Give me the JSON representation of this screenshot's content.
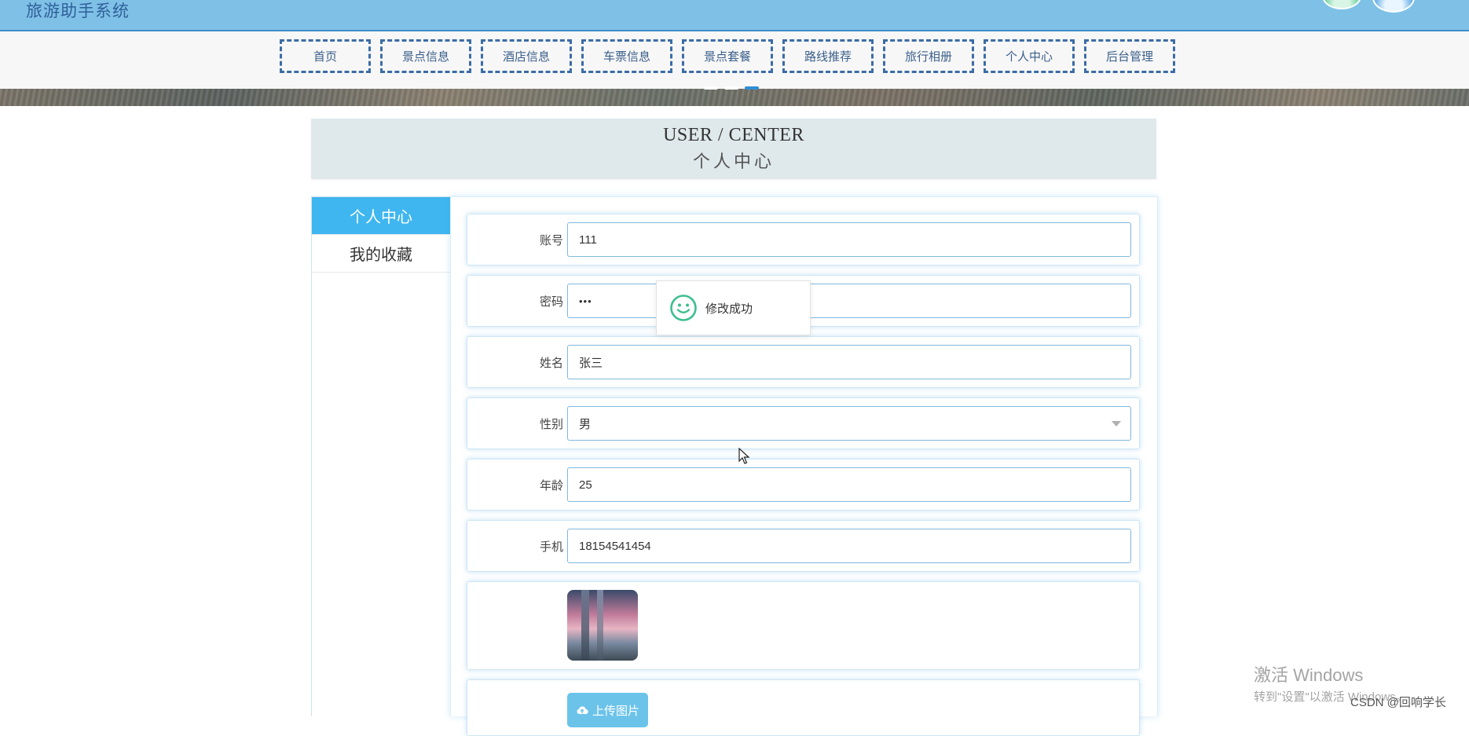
{
  "header": {
    "site_title": "旅游助手系统"
  },
  "nav": {
    "items": [
      "首页",
      "景点信息",
      "酒店信息",
      "车票信息",
      "景点套餐",
      "路线推荐",
      "旅行相册",
      "个人中心",
      "后台管理"
    ]
  },
  "section_header": {
    "title_en": "USER / CENTER",
    "title_cn": "个人中心"
  },
  "sidebar": {
    "items": [
      {
        "label": "个人中心",
        "active": true
      },
      {
        "label": "我的收藏",
        "active": false
      }
    ]
  },
  "form": {
    "account": {
      "label": "账号",
      "value": "111"
    },
    "password": {
      "label": "密码",
      "value": "•••"
    },
    "name": {
      "label": "姓名",
      "value": "张三"
    },
    "gender": {
      "label": "性别",
      "value": "男"
    },
    "age": {
      "label": "年龄",
      "value": "25"
    },
    "phone": {
      "label": "手机",
      "value": "18154541454"
    },
    "upload_button": "上传图片"
  },
  "toast": {
    "message": "修改成功"
  },
  "watermark": {
    "line1": "激活 Windows",
    "line2": "转到\"设置\"以激活 Windows。"
  },
  "credit": "CSDN @回响学长",
  "colors": {
    "topbar": "#7fc1e6",
    "nav_border": "#3b6ca6",
    "sidebar_active": "#3fb6ef",
    "upload_button": "#6cc3ea",
    "toast_icon": "#3dbf8f"
  }
}
